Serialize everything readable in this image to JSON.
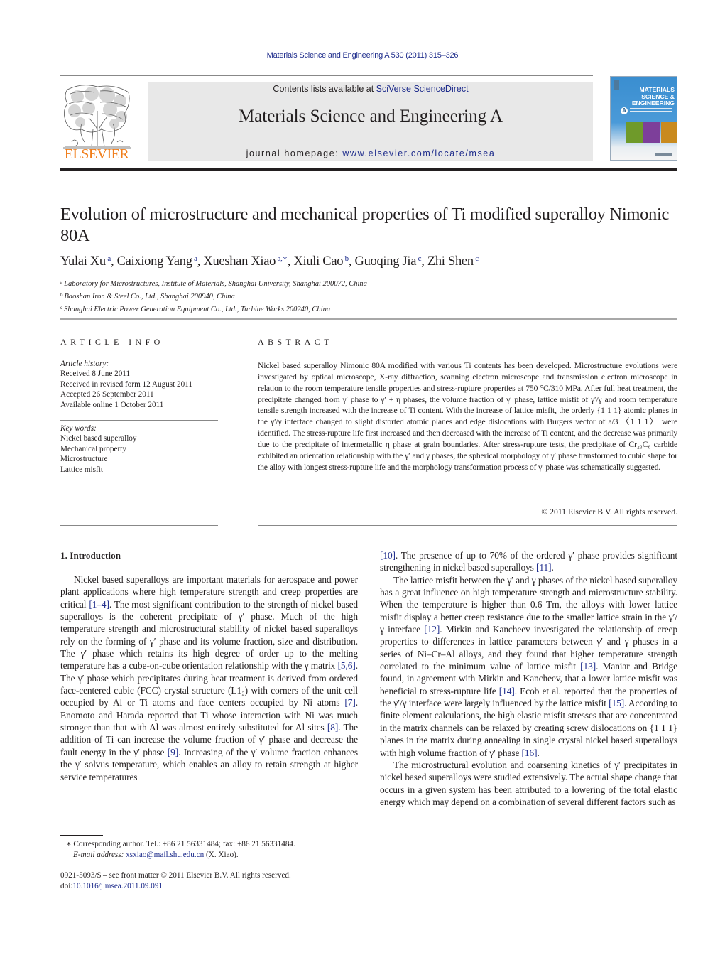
{
  "running_head": "Materials Science and Engineering A 530 (2011) 315–326",
  "masthead": {
    "publisher_logo": "ELSEVIER",
    "contents_prefix": "Contents lists available at ",
    "contents_link": "SciVerse ScienceDirect",
    "journal_title": "Materials Science and Engineering A",
    "homepage_prefix": "journal homepage: ",
    "homepage_link": "www.elsevier.com/locate/msea",
    "cover": {
      "line1": "MATERIALS",
      "line2": "SCIENCE &",
      "line3": "ENGINEERING",
      "badge": "A"
    }
  },
  "article": {
    "title": "Evolution of microstructure and mechanical properties of Ti modified superalloy Nimonic 80A",
    "authors": [
      {
        "name": "Yulai Xu",
        "aff": "a"
      },
      {
        "name": "Caixiong Yang",
        "aff": "a"
      },
      {
        "name": "Xueshan Xiao",
        "aff": "a,∗"
      },
      {
        "name": "Xiuli Cao",
        "aff": "b"
      },
      {
        "name": "Guoqing Jia",
        "aff": "c"
      },
      {
        "name": "Zhi Shen",
        "aff": "c"
      }
    ],
    "affiliations": [
      {
        "key": "a",
        "text": "Laboratory for Microstructures, Institute of Materials, Shanghai University, Shanghai 200072, China"
      },
      {
        "key": "b",
        "text": "Baoshan Iron & Steel Co., Ltd., Shanghai 200940, China"
      },
      {
        "key": "c",
        "text": "Shanghai Electric Power Generation Equipment Co., Ltd., Turbine Works 200240, China"
      }
    ]
  },
  "article_info": {
    "heading": "ARTICLE INFO",
    "history_label": "Article history:",
    "history": [
      "Received 8 June 2011",
      "Received in revised form 12 August 2011",
      "Accepted 26 September 2011",
      "Available online 1 October 2011"
    ],
    "keywords_label": "Key words:",
    "keywords": [
      "Nickel based superalloy",
      "Mechanical property",
      "Microstructure",
      "Lattice misfit"
    ]
  },
  "abstract": {
    "heading": "ABSTRACT",
    "text": "Nickel based superalloy Nimonic 80A modified with various Ti contents has been developed. Microstructure evolutions were investigated by optical microscope, X-ray diffraction, scanning electron microscope and transmission electron microscope in relation to the room temperature tensile properties and stress-rupture properties at 750 °C/310 MPa. After full heat treatment, the precipitate changed from γ′ phase to γ′ + η phases, the volume fraction of γ′ phase, lattice misfit of γ′/γ and room temperature tensile strength increased with the increase of Ti content. With the increase of lattice misfit, the orderly {1 1 1} atomic planes in the γ′/γ interface changed to slight distorted atomic planes and edge dislocations with Burgers vector of a/3 〈1 1 1〉 were identified. The stress-rupture life first increased and then decreased with the increase of Ti content, and the decrease was primarily due to the precipitate of intermetallic η phase at grain boundaries. After stress-rupture tests, the precipitate of Cr₂₃C₆ carbide exhibited an orientation relationship with the γ′ and γ phases, the spherical morphology of γ′ phase transformed to cubic shape for the alloy with longest stress-rupture life and the morphology transformation process of γ′ phase was schematically suggested.",
    "copyright": "© 2011 Elsevier B.V. All rights reserved."
  },
  "body": {
    "section_heading": "1.  Introduction",
    "left_paragraphs": [
      [
        {
          "t": "Nickel based superalloys are important materials for aerospace and power plant applications where high temperature strength and creep properties are critical "
        },
        {
          "ref": "[1–4]"
        },
        {
          "t": ". The most significant contribution to the strength of nickel based superalloys is the coherent precipitate of γ′ phase. Much of the high temperature strength and microstructural stability of nickel based superalloys rely on the forming of γ′ phase and its volume fraction, size and distribution. The γ′ phase which retains its high degree of order up to the melting temperature has a cube-on-cube orientation relationship with the γ matrix "
        },
        {
          "ref": "[5,6]"
        },
        {
          "t": ". The γ′ phase which precipitates during heat treatment is derived from ordered face-centered cubic (FCC) crystal structure (L1₂) with corners of the unit cell occupied by Al or Ti atoms and face centers occupied by Ni atoms "
        },
        {
          "ref": "[7]"
        },
        {
          "t": ". Enomoto and Harada reported that Ti whose interaction with Ni was much stronger than that with Al was almost entirely substituted for Al sites "
        },
        {
          "ref": "[8]"
        },
        {
          "t": ". The addition of Ti can increase the volume fraction of γ′ phase and decrease the fault energy in the γ′ phase "
        },
        {
          "ref": "[9]"
        },
        {
          "t": ". Increasing of the γ′ volume fraction enhances the γ′ solvus temperature, which enables an alloy to retain strength at higher service temperatures"
        }
      ]
    ],
    "right_paragraphs": [
      [
        {
          "ref": "[10]"
        },
        {
          "t": ". The presence of up to 70% of the ordered γ′ phase provides significant strengthening in nickel based superalloys "
        },
        {
          "ref": "[11]"
        },
        {
          "t": "."
        }
      ],
      [
        {
          "t": "The lattice misfit between the γ′ and γ phases of the nickel based superalloy has a great influence on high temperature strength and microstructure stability. When the temperature is higher than 0.6 Tm, the alloys with lower lattice misfit display a better creep resistance due to the smaller lattice strain in the γ′/γ interface "
        },
        {
          "ref": "[12]"
        },
        {
          "t": ". Mirkin and Kancheev investigated the relationship of creep properties to differences in lattice parameters between γ′ and γ phases in a series of Ni–Cr–Al alloys, and they found that higher temperature strength correlated to the minimum value of lattice misfit "
        },
        {
          "ref": "[13]"
        },
        {
          "t": ". Maniar and Bridge found, in agreement with Mirkin and Kancheev, that a lower lattice misfit was beneficial to stress-rupture life "
        },
        {
          "ref": "[14]"
        },
        {
          "t": ". Ecob et al. reported that the properties of the γ′/γ interface were largely influenced by the lattice misfit "
        },
        {
          "ref": "[15]"
        },
        {
          "t": ". According to finite element calculations, the high elastic misfit stresses that are concentrated in the matrix channels can be relaxed by creating screw dislocations on {1 1 1} planes in the matrix during annealing in single crystal nickel based superalloys with high volume fraction of γ′ phase "
        },
        {
          "ref": "[16]"
        },
        {
          "t": "."
        }
      ],
      [
        {
          "t": "The microstructural evolution and coarsening kinetics of γ′ precipitates in nickel based superalloys were studied extensively. The actual shape change that occurs in a given system has been attributed to a lowering of the total elastic energy which may depend on a combination of several different factors such as"
        }
      ]
    ]
  },
  "footnotes": {
    "corresponding": "∗  Corresponding author. Tel.: +86 21 56331484; fax: +86 21 56331484.",
    "email_label": "E-mail address: ",
    "email": "xsxiao@mail.shu.edu.cn",
    "email_suffix": " (X. Xiao).",
    "issn_line": "0921-5093/$ – see front matter © 2011 Elsevier B.V. All rights reserved.",
    "doi_prefix": "doi:",
    "doi": "10.1016/j.msea.2011.09.091"
  },
  "colors": {
    "link": "#1f2d8c",
    "elsevier_orange": "#f07e1b",
    "band_gray": "#e8e8e8"
  }
}
